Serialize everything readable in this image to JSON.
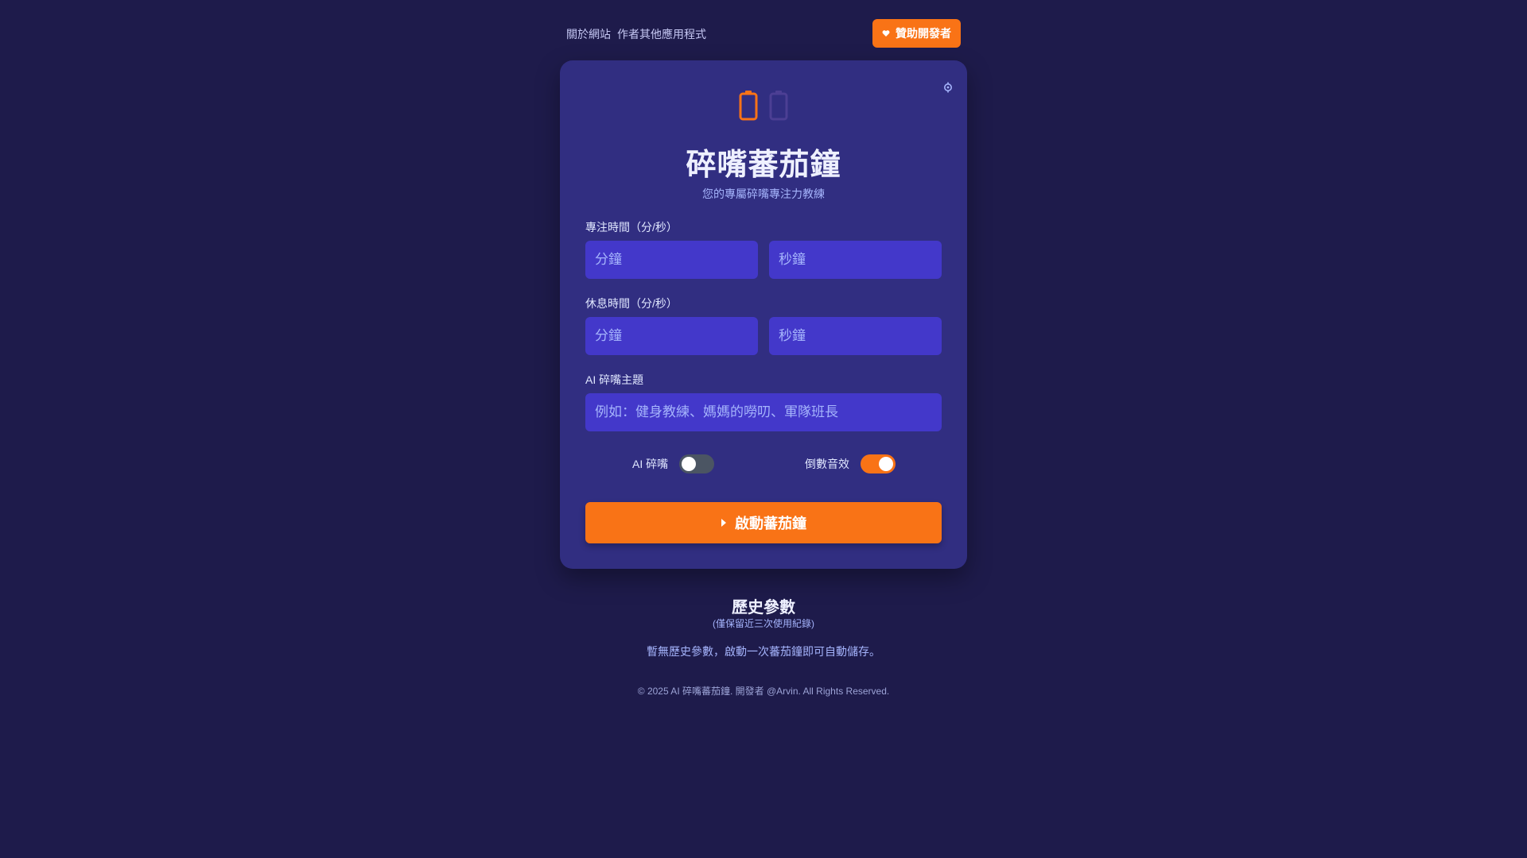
{
  "nav": {
    "links": [
      "關於網站",
      "作者其他應用程式"
    ],
    "sponsor_label": "贊助開發者"
  },
  "card": {
    "title": "碎嘴蕃茄鐘",
    "subtitle": "您的專屬碎嘴專注力教練",
    "focus": {
      "label": "專注時間（分/秒）",
      "minutes_placeholder": "分鐘",
      "seconds_placeholder": "秒鐘",
      "minutes_value": "",
      "seconds_value": ""
    },
    "rest": {
      "label": "休息時間（分/秒）",
      "minutes_placeholder": "分鐘",
      "seconds_placeholder": "秒鐘",
      "minutes_value": "",
      "seconds_value": ""
    },
    "theme": {
      "label": "AI 碎嘴主題",
      "placeholder": "例如：健身教練、媽媽的嘮叨、軍隊班長",
      "value": ""
    },
    "toggles": [
      {
        "label": "AI 碎嘴",
        "on": false
      },
      {
        "label": "倒數音效",
        "on": true
      }
    ],
    "start_label": "啟動蕃茄鐘"
  },
  "history": {
    "title": "歷史參數",
    "note": "(僅保留近三次使用紀錄)",
    "empty": "暫無歷史參數，啟動一次蕃茄鐘即可自動儲存。"
  },
  "footer": "© 2025 AI 碎嘴蕃茄鐘. 開發者 @Arvin. All Rights Reserved.",
  "colors": {
    "background": "#1e1b4b",
    "card": "#312e81",
    "input": "#4338ca",
    "accent": "#f97316"
  },
  "icons": {
    "sponsor": "heart-icon",
    "settings": "gear-icon",
    "hero": [
      "tomato-icon",
      "chat-bubble-icon"
    ],
    "start": "play-icon"
  }
}
